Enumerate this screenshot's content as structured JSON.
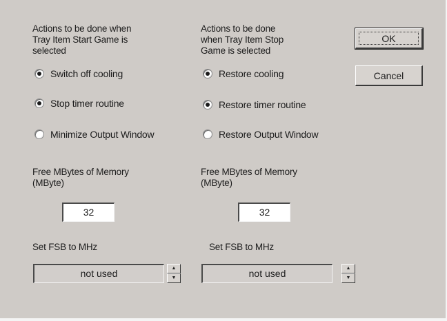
{
  "left": {
    "heading": "Actions to be done when\nTray Item Start Game is\nselected",
    "options": [
      {
        "label": "Switch off cooling",
        "checked": true
      },
      {
        "label": "Stop timer routine",
        "checked": true
      },
      {
        "label": "Minimize Output Window",
        "checked": false
      }
    ],
    "memory_label": "Free MBytes of Memory\n(MByte)",
    "memory_value": "32",
    "fsb_label": "Set FSB to MHz",
    "fsb_value": "not used"
  },
  "right": {
    "heading": "Actions to be done\nwhen Tray Item Stop\nGame is selected",
    "options": [
      {
        "label": "Restore cooling",
        "checked": true
      },
      {
        "label": "Restore timer routine",
        "checked": true
      },
      {
        "label": "Restore Output Window",
        "checked": false
      }
    ],
    "memory_label": "Free MBytes of Memory\n(MByte)",
    "memory_value": "32",
    "fsb_label": "Set FSB to MHz",
    "fsb_value": "not used"
  },
  "buttons": {
    "ok": "OK",
    "cancel": "Cancel"
  },
  "icons": {
    "spin_up": "spin-up-icon",
    "spin_down": "spin-down-icon"
  },
  "colors": {
    "dialog_bg": "#cfcbc7"
  }
}
